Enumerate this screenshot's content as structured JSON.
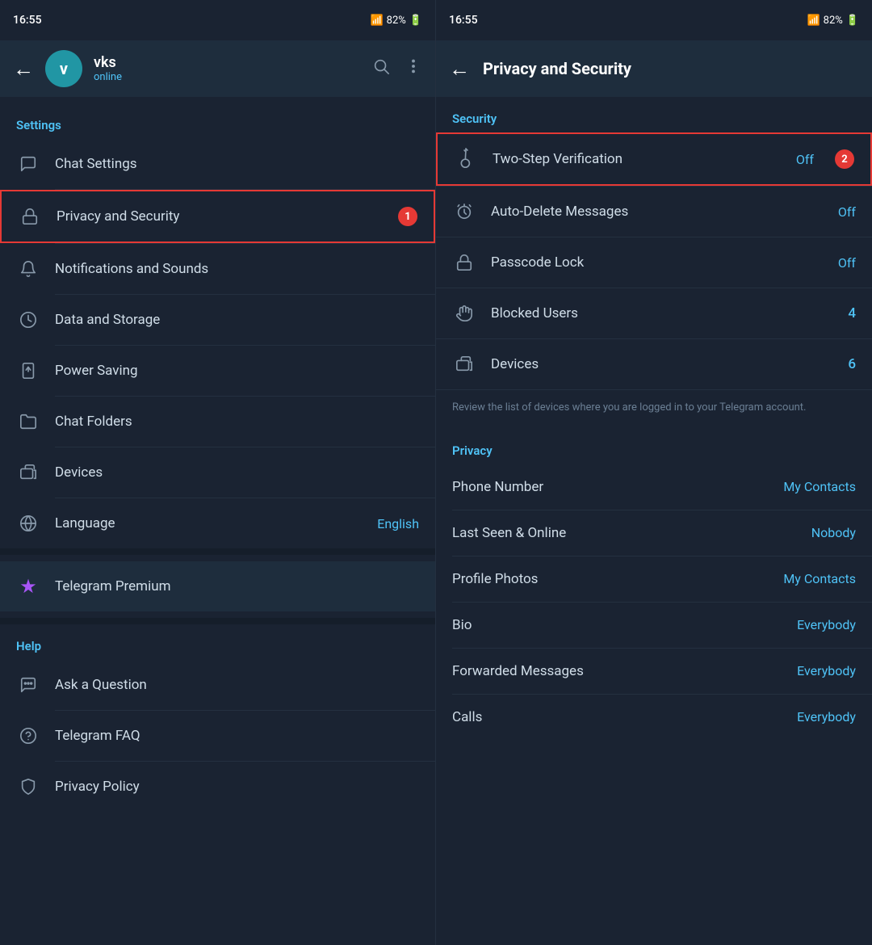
{
  "left": {
    "statusBar": {
      "time": "16:55",
      "battery": "82%"
    },
    "topBar": {
      "backLabel": "←",
      "avatarLetter": "v",
      "userName": "vks",
      "userStatus": "online",
      "searchLabel": "🔍",
      "menuLabel": "⋮"
    },
    "settingsTitle": "Settings",
    "menuItems": [
      {
        "id": "chat-settings",
        "label": "Chat Settings",
        "icon": "chat",
        "value": "",
        "highlighted": false
      },
      {
        "id": "privacy-security",
        "label": "Privacy and Security",
        "icon": "lock",
        "value": "",
        "highlighted": true,
        "badge": "1"
      },
      {
        "id": "notifications",
        "label": "Notifications and Sounds",
        "icon": "bell",
        "value": "",
        "highlighted": false
      },
      {
        "id": "data-storage",
        "label": "Data and Storage",
        "icon": "clock",
        "value": "",
        "highlighted": false
      },
      {
        "id": "power-saving",
        "label": "Power Saving",
        "icon": "power",
        "value": "",
        "highlighted": false
      },
      {
        "id": "chat-folders",
        "label": "Chat Folders",
        "icon": "folder",
        "value": "",
        "highlighted": false
      },
      {
        "id": "devices",
        "label": "Devices",
        "icon": "devices",
        "value": "",
        "highlighted": false
      },
      {
        "id": "language",
        "label": "Language",
        "icon": "globe",
        "value": "English",
        "highlighted": false
      }
    ],
    "premiumItem": {
      "label": "Telegram Premium",
      "icon": "star"
    },
    "helpTitle": "Help",
    "helpItems": [
      {
        "id": "ask-question",
        "label": "Ask a Question",
        "icon": "chat-bubble"
      },
      {
        "id": "telegram-faq",
        "label": "Telegram FAQ",
        "icon": "question"
      },
      {
        "id": "privacy-policy",
        "label": "Privacy Policy",
        "icon": "shield"
      }
    ]
  },
  "right": {
    "statusBar": {
      "time": "16:55",
      "battery": "82%"
    },
    "topBar": {
      "backLabel": "←",
      "title": "Privacy and Security"
    },
    "securityTitle": "Security",
    "securityItems": [
      {
        "id": "two-step",
        "label": "Two-Step Verification",
        "icon": "key",
        "value": "Off",
        "highlighted": true,
        "badge": "2"
      },
      {
        "id": "auto-delete",
        "label": "Auto-Delete Messages",
        "icon": "timer",
        "value": "Off",
        "highlighted": false
      },
      {
        "id": "passcode",
        "label": "Passcode Lock",
        "icon": "lock",
        "value": "Off",
        "highlighted": false
      },
      {
        "id": "blocked",
        "label": "Blocked Users",
        "icon": "hand",
        "value": "4",
        "highlighted": false
      },
      {
        "id": "devices",
        "label": "Devices",
        "icon": "devices",
        "value": "6",
        "highlighted": false
      }
    ],
    "devicesHint": "Review the list of devices where you are logged in to your Telegram account.",
    "privacyTitle": "Privacy",
    "privacyItems": [
      {
        "id": "phone-number",
        "label": "Phone Number",
        "value": "My Contacts"
      },
      {
        "id": "last-seen",
        "label": "Last Seen & Online",
        "value": "Nobody"
      },
      {
        "id": "profile-photos",
        "label": "Profile Photos",
        "value": "My Contacts"
      },
      {
        "id": "bio",
        "label": "Bio",
        "value": "Everybody"
      },
      {
        "id": "forwarded",
        "label": "Forwarded Messages",
        "value": "Everybody"
      },
      {
        "id": "calls",
        "label": "Calls",
        "value": "Everybody"
      }
    ]
  }
}
